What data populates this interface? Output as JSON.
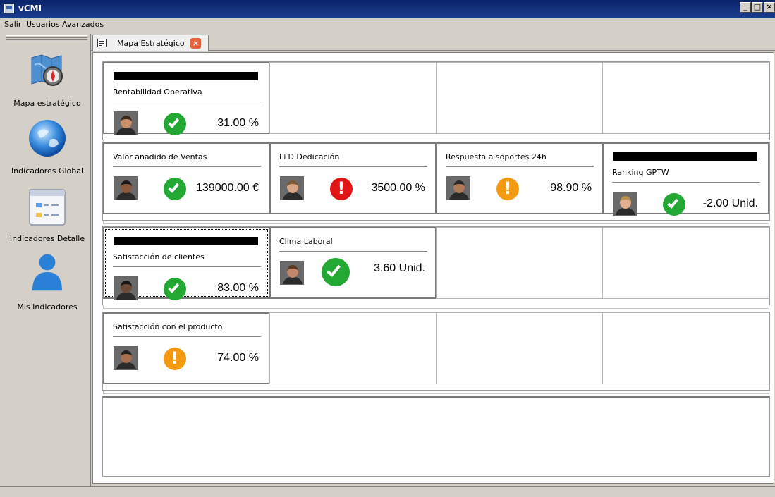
{
  "window": {
    "title": "vCMI",
    "minimize": "_",
    "maximize": "□",
    "close": "×"
  },
  "menu": [
    "Salir",
    "Usuarios Avanzados"
  ],
  "sidebar": {
    "items": [
      {
        "label": "Mapa estratégico",
        "icon": "strategic-map-icon"
      },
      {
        "label": "Indicadores Global",
        "icon": "globe-icon"
      },
      {
        "label": "Indicadores Detalle",
        "icon": "detail-window-icon"
      },
      {
        "label": "Mis Indicadores",
        "icon": "user-icon"
      }
    ]
  },
  "tab": {
    "label": "Mapa Estratégico",
    "close": "×"
  },
  "status_colors": {
    "ok": "#22a833",
    "bad": "#e01616",
    "warn": "#f39a10"
  },
  "rows": [
    {
      "cells": [
        {
          "label": "Rentabilidad Operativa",
          "value": "31.00 %",
          "status": "ok",
          "redacted": true
        },
        null,
        null,
        null
      ]
    },
    {
      "cells": [
        {
          "label": "Valor añadido de Ventas",
          "value": "139000.00 €",
          "status": "ok",
          "redacted": false
        },
        {
          "label": "I+D Dedicación",
          "value": "3500.00 %",
          "status": "bad",
          "redacted": false
        },
        {
          "label": "Respuesta a soportes 24h",
          "value": "98.90 %",
          "status": "warn",
          "redacted": false
        },
        {
          "label": "Ranking GPTW",
          "value": "-2.00 Unid.",
          "status": "ok",
          "redacted": true
        }
      ]
    },
    {
      "cells": [
        {
          "label": "Satisfacción de clientes",
          "value": "83.00 %",
          "status": "ok",
          "redacted": true
        },
        {
          "label": "Clima Laboral",
          "value": "3.60 Unid.",
          "status": "ok",
          "redacted": false
        },
        null,
        null
      ]
    },
    {
      "cells": [
        {
          "label": "Satisfacción con el producto",
          "value": "74.00 %",
          "status": "warn",
          "redacted": false
        },
        null,
        null,
        null
      ]
    }
  ]
}
